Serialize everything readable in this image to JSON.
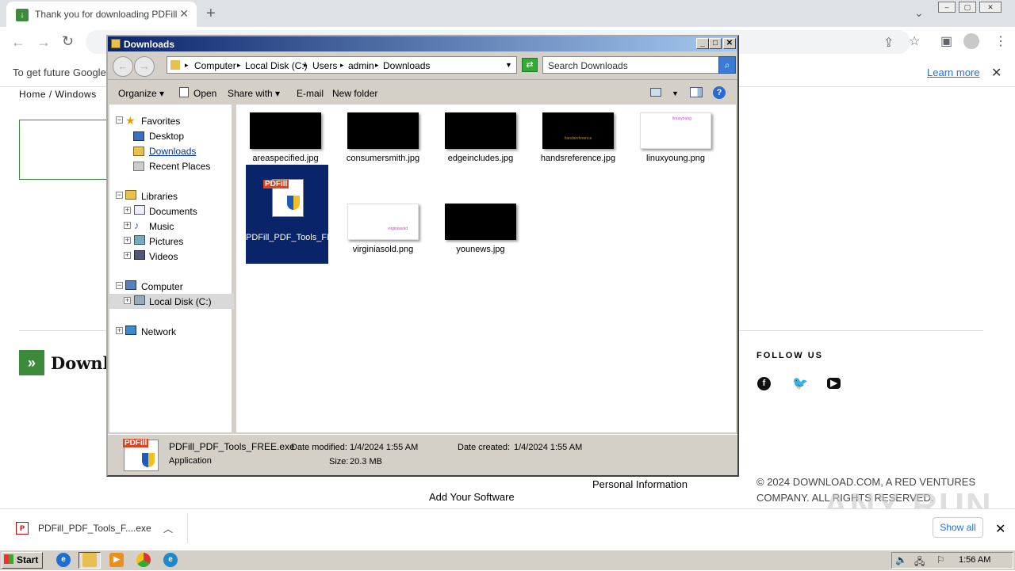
{
  "browser": {
    "tab_title": "Thank you for downloading PDFill Fre",
    "tab_favicon": "download-icon",
    "new_tab": "+",
    "infobar_text": "To get future Google",
    "learn_more": "Learn more"
  },
  "page": {
    "breadcrumb": "Home  /  Windows",
    "logo_text": "Downl",
    "follow_us": "FOLLOW US",
    "copyright": "© 2024 DOWNLOAD.COM, A RED VENTURES COMPANY. ALL RIGHTS RESERVED.",
    "personal_info": "Personal Information",
    "add_software": "Add Your Software",
    "watermark": "ANY RUN"
  },
  "explorer": {
    "title": "Downloads",
    "address": [
      "Computer",
      "Local Disk (C:)",
      "Users",
      "admin",
      "Downloads"
    ],
    "search_placeholder": "Search Downloads",
    "commands": {
      "organize": "Organize",
      "open": "Open",
      "share_with": "Share with",
      "email": "E-mail",
      "new_folder": "New folder"
    },
    "nav": {
      "favorites": "Favorites",
      "desktop": "Desktop",
      "downloads": "Downloads",
      "recent": "Recent Places",
      "libraries": "Libraries",
      "documents": "Documents",
      "music": "Music",
      "pictures": "Pictures",
      "videos": "Videos",
      "computer": "Computer",
      "local_disk": "Local Disk (C:)",
      "network": "Network"
    },
    "files": [
      {
        "name": "areaspecified.jpg",
        "thumb": "dark"
      },
      {
        "name": "consumersmith.jpg",
        "thumb": "dark"
      },
      {
        "name": "edgeincludes.jpg",
        "thumb": "dark"
      },
      {
        "name": "handsreference.jpg",
        "thumb": "dark",
        "thumb_text": "handsreference"
      },
      {
        "name": "linuxyoung.png",
        "thumb": "light",
        "thumb_text": "linuxyoung"
      },
      {
        "name": "PDFill_PDF_Tools_FREE.exe",
        "thumb": "app",
        "selected": true
      },
      {
        "name": "virginiasold.png",
        "thumb": "light",
        "thumb_text": "virginiasold"
      },
      {
        "name": "younews.jpg",
        "thumb": "dark"
      }
    ],
    "pdfill_label": "PDFill",
    "status": {
      "name": "PDFill_PDF_Tools_FREE.exe",
      "type": "Application",
      "date_modified_label": "Date modified:",
      "date_modified": "1/4/2024 1:55 AM",
      "size_label": "Size:",
      "size": "20.3 MB",
      "date_created_label": "Date created:",
      "date_created": "1/4/2024 1:55 AM"
    }
  },
  "downloads_bar": {
    "file": "PDFill_PDF_Tools_F....exe",
    "show_all": "Show all"
  },
  "taskbar": {
    "start": "Start",
    "clock": "1:56 AM"
  },
  "colors": {
    "accent": "#3e8a3c",
    "title_bar": "#0a246a",
    "selection": "#0a246a"
  }
}
